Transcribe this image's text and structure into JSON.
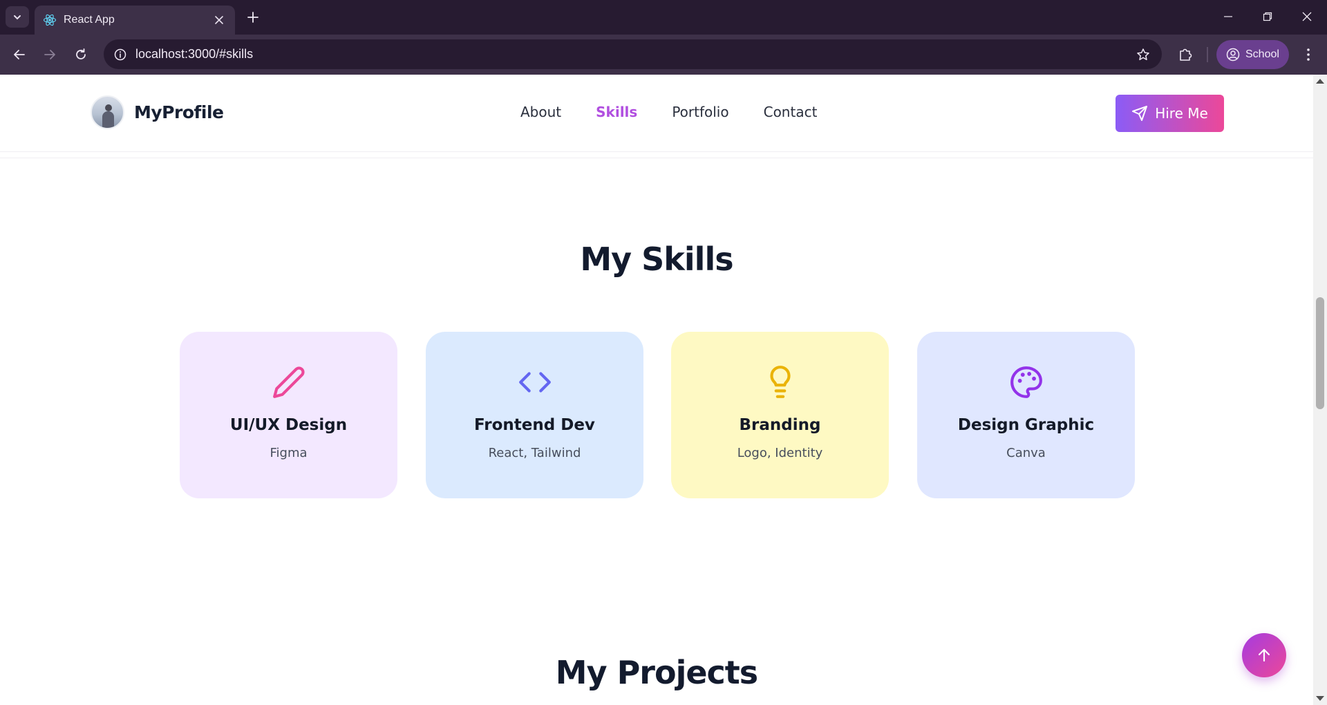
{
  "browser": {
    "tab_title": "React App",
    "url": "localhost:3000/#skills",
    "profile_label": "School"
  },
  "header": {
    "brand": "MyProfile",
    "nav": [
      {
        "label": "About",
        "active": false
      },
      {
        "label": "Skills",
        "active": true
      },
      {
        "label": "Portfolio",
        "active": false
      },
      {
        "label": "Contact",
        "active": false
      }
    ],
    "cta_label": "Hire Me"
  },
  "skills": {
    "title": "My Skills",
    "cards": [
      {
        "icon": "pencil-icon",
        "title": "UI/UX Design",
        "subtitle": "Figma",
        "bg": "#f3e8ff",
        "icon_color": "#ec4899"
      },
      {
        "icon": "code-icon",
        "title": "Frontend Dev",
        "subtitle": "React, Tailwind",
        "bg": "#dbeafe",
        "icon_color": "#6366f1"
      },
      {
        "icon": "lightbulb-icon",
        "title": "Branding",
        "subtitle": "Logo, Identity",
        "bg": "#fef9c3",
        "icon_color": "#eab308"
      },
      {
        "icon": "palette-icon",
        "title": "Design Graphic",
        "subtitle": "Canva",
        "bg": "#e0e7ff",
        "icon_color": "#9333ea"
      }
    ]
  },
  "projects": {
    "title": "My Projects"
  },
  "colors": {
    "accent_gradient_start": "#8b5cf6",
    "accent_gradient_end": "#ec4899",
    "active_nav": "#b14fe0",
    "chrome_dark": "#271b31",
    "chrome_mid": "#3d3048"
  }
}
